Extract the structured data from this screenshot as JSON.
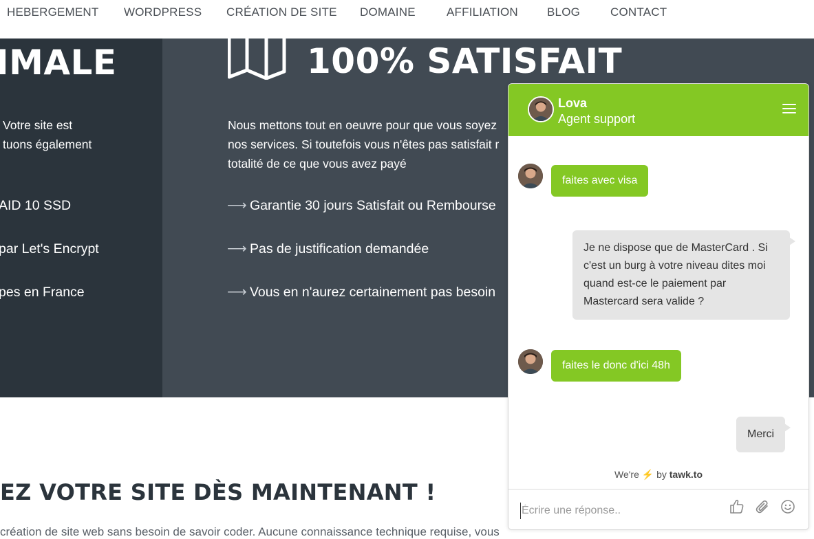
{
  "nav": {
    "items": [
      "HEBERGEMENT",
      "WORDPRESS",
      "CRÉATION DE SITE",
      "DOMAINE",
      "AFFILIATION",
      "BLOG",
      "CONTACT"
    ]
  },
  "hero_left": {
    "title": "IMALE",
    "text_lines": [
      "Votre site est",
      "tuons également"
    ],
    "list": [
      "AID 10 SSD",
      "par Let's Encrypt",
      "pes en France"
    ]
  },
  "hero_right": {
    "title": "100% SATISFAIT",
    "text_lines": [
      "Nous mettons tout en oeuvre pour que vous soyez",
      "nos services. Si toutefois vous n'êtes pas satisfait r",
      "totalité de ce que vous avez payé"
    ],
    "list": [
      "Garantie 30 jours Satisfait ou Rembourse",
      "Pas de justification demandée",
      "Vous en n'aurez certainement pas besoin"
    ]
  },
  "section": {
    "title": "EZ VOTRE SITE DÈS MAINTENANT !",
    "body": "création de site web sans besoin de savoir coder. Aucune connaissance technique requise, vous"
  },
  "chat": {
    "agent_name": "Lova",
    "agent_role": "Agent support",
    "messages": [
      {
        "from": "agent",
        "text": "faites avec visa"
      },
      {
        "from": "visitor",
        "text": "Je ne dispose que de MasterCard . Si c'est un burg à votre niveau dites moi quand est-ce le paiement par Mastercard sera valide  ?"
      },
      {
        "from": "agent",
        "text": "faites le donc d'ici 48h"
      },
      {
        "from": "visitor",
        "text": "Merci"
      }
    ],
    "powered_prefix": "We're",
    "powered_by": "by",
    "powered_brand": "tawk.to",
    "input_placeholder": "Écrire une réponse..",
    "colors": {
      "accent": "#84c824",
      "visitor_bubble": "#e5e5e5"
    },
    "icons": [
      "menu-icon",
      "thumbs-up-icon",
      "paperclip-icon",
      "smiley-icon"
    ]
  }
}
